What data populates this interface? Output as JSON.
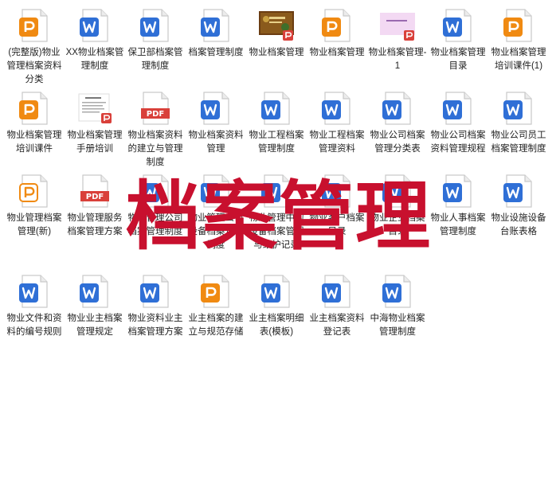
{
  "colors": {
    "ppt": "#f08a12",
    "ppt_outline": "#f08a12",
    "word": "#2f6fd6",
    "pdf": "#d9403a",
    "watermark": "#c8102e",
    "label": "#222222"
  },
  "items": [
    {
      "name": "file-wanzhengban-wuye-guanli-dangan-ziliao-fenlei",
      "type": "ppt",
      "label": "(完整版)物业管理档案资料分类"
    },
    {
      "name": "file-xx-wuye-dangan-guanli-zhidu",
      "type": "word",
      "label": "XX物业档案管理制度"
    },
    {
      "name": "file-baoweibu-dangan-guanli-zhidu",
      "type": "word",
      "label": "保卫部档案管理制度"
    },
    {
      "name": "file-dangan-guanli-zhidu",
      "type": "word",
      "label": "档案管理制度"
    },
    {
      "name": "file-wuye-dangan-guanli-thumb",
      "type": "thumb-dark",
      "label": "物业档案管理"
    },
    {
      "name": "file-wuye-dangan-guanli",
      "type": "ppt",
      "label": "物业档案管理"
    },
    {
      "name": "file-wuye-dangan-guanli-1",
      "type": "thumb-pink",
      "label": "物业档案管理-1"
    },
    {
      "name": "file-wuye-dangan-guanli-mulu",
      "type": "word",
      "label": "物业档案管理目录"
    },
    {
      "name": "file-wuye-dangan-guanli-peixun-kejian-1",
      "type": "ppt",
      "label": "物业档案管理培训课件(1)"
    },
    {
      "name": "file-wuye-dangan-guanli-peixun-kejian",
      "type": "ppt",
      "label": "物业档案管理培训课件"
    },
    {
      "name": "file-wuye-dangan-guanli-shouce-peixun",
      "type": "thumb-doc",
      "label": "物业档案管理手册培训"
    },
    {
      "name": "file-wuye-dangan-ziliao-jianli",
      "type": "pdf",
      "label": "物业档案资料的建立与管理制度"
    },
    {
      "name": "file-wuye-dangan-ziliao-guanli",
      "type": "word",
      "label": "物业档案资料管理"
    },
    {
      "name": "file-wuye-gongcheng-dangan-guanli-zhidu",
      "type": "word",
      "label": "物业工程档案管理制度"
    },
    {
      "name": "file-wuye-gongcheng-dangan-guanli-ziliao",
      "type": "word",
      "label": "物业工程档案管理资料"
    },
    {
      "name": "file-wuye-gongsi-dangan-guanli-fenlei-biao",
      "type": "word",
      "label": "物业公司档案管理分类表"
    },
    {
      "name": "file-wuye-gongsi-dangan-ziliao-guanli-guicheng",
      "type": "word",
      "label": "物业公司档案资料管理规程"
    },
    {
      "name": "file-wuye-gongsi-yuangong-dangan-guanli-zhidu",
      "type": "word",
      "label": "物业公司员工档案管理制度"
    },
    {
      "name": "file-wuye-guanli-dangan-guanli-xin",
      "type": "ppt-outline",
      "label": "物业管理档案管理(新)"
    },
    {
      "name": "file-wuye-guanli-fuwu-dangan-guanli-fangan",
      "type": "pdf",
      "label": "物业管理服务档案管理方案"
    },
    {
      "name": "file-wuye-guanli-gongsi-dangan-guanli-zhidu",
      "type": "word",
      "label": "物业管理公司档案管理制度"
    },
    {
      "name": "file-wuye-guanli-gongsi-shebei-dangan-guanli-zhidu",
      "type": "word",
      "label": "物业管理公司设备档案管理制度"
    },
    {
      "name": "file-wuye-guanli-shebei-dangan-weixiu-jilu",
      "type": "word",
      "label": "物业管理中的设备档案管理与维护记录"
    },
    {
      "name": "file-wuye-kehu-dangan-mulu",
      "type": "word",
      "label": "物业客户档案目录"
    },
    {
      "name": "file-wuye-qiye-dangan-mulu",
      "type": "word",
      "label": "物业企业档案目录"
    },
    {
      "name": "file-wuye-renshi-dangan-guanli-zhidu",
      "type": "word",
      "label": "物业人事档案管理制度"
    },
    {
      "name": "file-wuye-sheshi-shebei-taizhang-biaoge",
      "type": "word",
      "label": "物业设施设备台账表格"
    },
    {
      "name": "file-wuye-wenjian-ziliao-bianhao-guize",
      "type": "word",
      "label": "物业文件和资料的编号规则"
    },
    {
      "name": "file-wuye-yezhu-dangan-guanli-guiding",
      "type": "word",
      "label": "物业业主档案管理规定"
    },
    {
      "name": "file-wuye-ziliao-yezhu-dangan-guanli-fangan",
      "type": "word",
      "label": "物业资料业主档案管理方案"
    },
    {
      "name": "file-yezhu-dangan-jianli-guifan-cunchu",
      "type": "ppt",
      "label": "业主档案的建立与规范存储"
    },
    {
      "name": "file-yezhu-dangan-mingxibiao-muban",
      "type": "word",
      "label": "业主档案明细表(模板)"
    },
    {
      "name": "file-yezhu-dangan-ziliao-dengjibiao",
      "type": "word",
      "label": "业主档案资料登记表"
    },
    {
      "name": "file-zhonghai-wuye-dangan-guanli-zhidu",
      "type": "word",
      "label": "中海物业档案管理制度"
    }
  ],
  "watermark": {
    "text": "档案管理"
  }
}
